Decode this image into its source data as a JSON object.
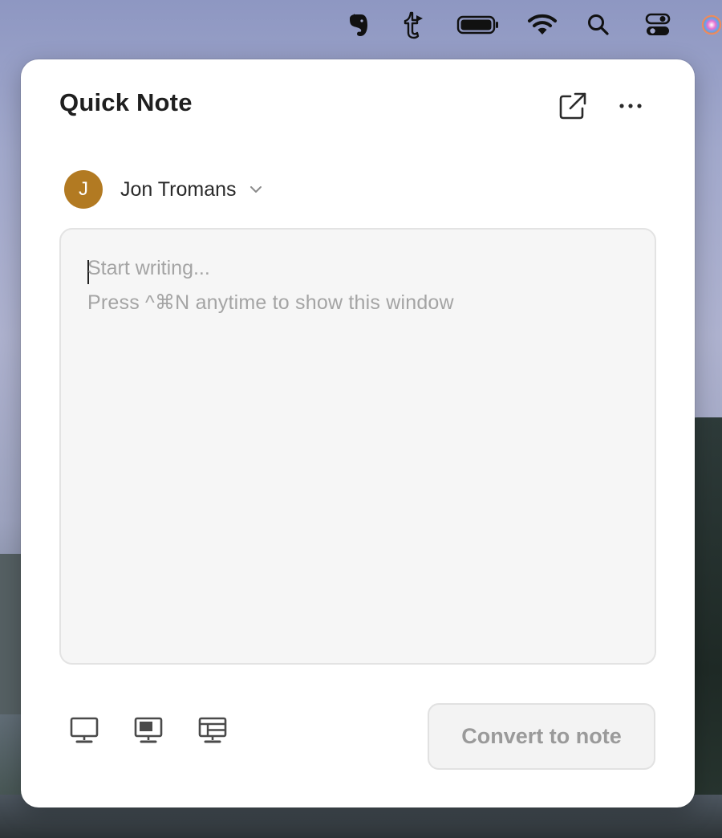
{
  "menubar": {
    "icons": [
      "evernote-icon",
      "tumblr-icon",
      "battery-icon",
      "wifi-icon",
      "spotlight-search-icon",
      "control-center-icon",
      "siri-icon"
    ]
  },
  "quick_note": {
    "title": "Quick Note",
    "user": {
      "initial": "J",
      "name": "Jon Tromans",
      "avatar_color": "#b27a22"
    },
    "editor": {
      "placeholder": "Start writing...",
      "hint": "Press ^⌘N anytime to show this window"
    },
    "layout_icons": [
      "monitor-outline-icon",
      "monitor-filled-icon",
      "monitor-grid-icon"
    ],
    "convert_label": "Convert to note"
  }
}
